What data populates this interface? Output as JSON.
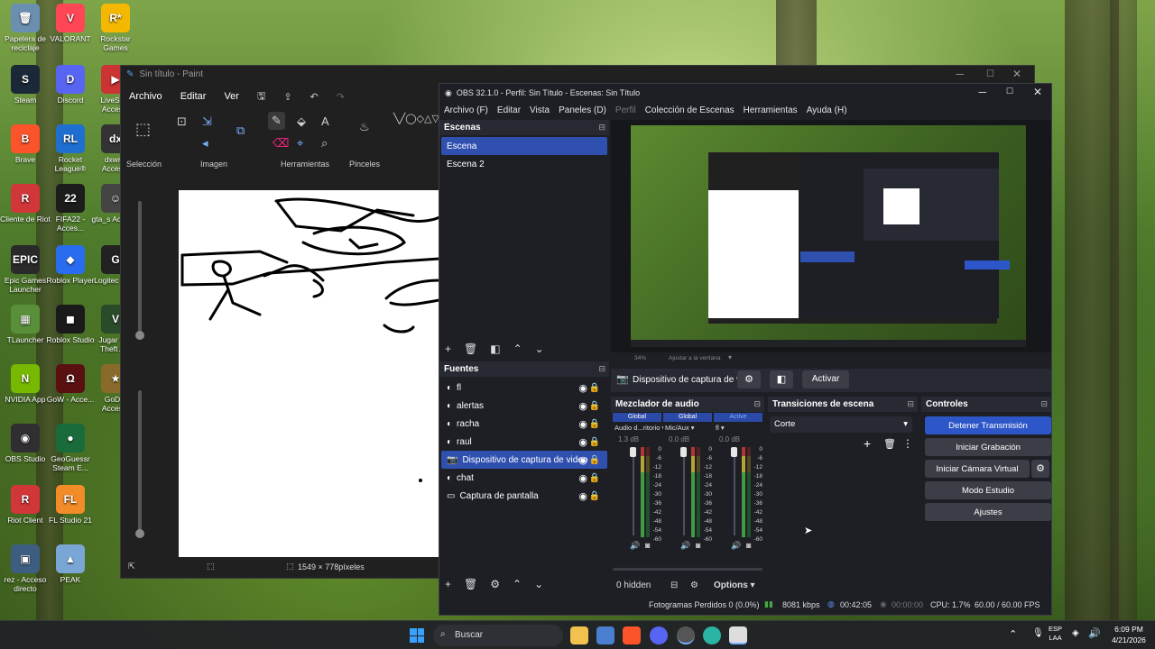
{
  "desktop": {
    "icons": [
      {
        "label": "Papelera de reciclaje",
        "color": "#6b8fb0",
        "glyph": "🗑"
      },
      {
        "label": "Steam",
        "color": "#1b2838",
        "glyph": "S"
      },
      {
        "label": "Brave",
        "color": "#fb542b",
        "glyph": "B"
      },
      {
        "label": "Cliente de Riot",
        "color": "#d13639",
        "glyph": "R"
      },
      {
        "label": "Epic Games Launcher",
        "color": "#2a2a2a",
        "glyph": "EPIC"
      },
      {
        "label": "TLauncher",
        "color": "#5a8f3a",
        "glyph": "▦"
      },
      {
        "label": "NVIDIA App",
        "color": "#76b900",
        "glyph": "N"
      },
      {
        "label": "OBS Studio",
        "color": "#302e31",
        "glyph": "◉"
      },
      {
        "label": "Riot Client",
        "color": "#d13639",
        "glyph": "R"
      },
      {
        "label": "rez - Acceso directo",
        "color": "#3d5e80",
        "glyph": "▣"
      },
      {
        "label": "VALORANT",
        "color": "#ff4655",
        "glyph": "V"
      },
      {
        "label": "Discord",
        "color": "#5865f2",
        "glyph": "D"
      },
      {
        "label": "Rocket League®",
        "color": "#1f6fd1",
        "glyph": "RL"
      },
      {
        "label": "FIFA22 - Acces...",
        "color": "#1c1c1c",
        "glyph": "22"
      },
      {
        "label": "Roblox Player",
        "color": "#2a6cf0",
        "glyph": "◆"
      },
      {
        "label": "Roblox Studio",
        "color": "#1a1a1a",
        "glyph": "◼"
      },
      {
        "label": "GoW - Acce...",
        "color": "#5a1010",
        "glyph": "Ω"
      },
      {
        "label": "GeoGuessr Steam E...",
        "color": "#1a6b3c",
        "glyph": "●"
      },
      {
        "label": "FL Studio 21",
        "color": "#f28c28",
        "glyph": "FL"
      },
      {
        "label": "PEAK",
        "color": "#7aa6d6",
        "glyph": "▲"
      },
      {
        "label": "Rockstar Games",
        "color": "#f5b800",
        "glyph": "R*"
      },
      {
        "label": "LiveSp... Acces...",
        "color": "#c33",
        "glyph": "▶"
      },
      {
        "label": "dxwnd Acces...",
        "color": "#333",
        "glyph": "dx"
      },
      {
        "label": "gta_s Acces...",
        "color": "#444",
        "glyph": "☺"
      },
      {
        "label": "Logitec HUB",
        "color": "#222",
        "glyph": "G"
      },
      {
        "label": "Jugar G... Theft A...",
        "color": "#2a4a2a",
        "glyph": "V"
      },
      {
        "label": "GoD... Acces...",
        "color": "#8a6a2a",
        "glyph": "★"
      }
    ]
  },
  "paint": {
    "title": "Sin título - Paint",
    "menu": [
      "Archivo",
      "Editar",
      "Ver"
    ],
    "groups": [
      "Selección",
      "Imagen",
      "Herramientas",
      "Pinceles"
    ],
    "status_size": "1549 × 778píxeles"
  },
  "obs": {
    "title": "OBS 32.1.0 - Perfil: Sin Título - Escenas: Sin Título",
    "menu": [
      "Archivo (F)",
      "Editar",
      "Vista",
      "Paneles (D)",
      "Perfil",
      "Colección de Escenas",
      "Herramientas",
      "Ayuda (H)"
    ],
    "scenes": {
      "header": "Escenas",
      "items": [
        "Escena",
        "Escena 2"
      ]
    },
    "sources": {
      "header": "Fuentes",
      "items": [
        "fl",
        "alertas",
        "racha",
        "raul",
        "Dispositivo de captura de video",
        "chat",
        "Captura de pantalla"
      ]
    },
    "preview": {
      "zoom": "34%",
      "fit": "Ajustar a la ventana"
    },
    "source_bar": {
      "name": "Dispositivo de captura de v",
      "activate": "Activar"
    },
    "mixer": {
      "header": "Mezclador de audio",
      "channels": [
        {
          "tag": "Global",
          "name": "Audio d...ritorio",
          "db": "1.3 dB"
        },
        {
          "tag": "Global",
          "name": "Mic/Aux",
          "db": "0.0 dB"
        },
        {
          "tag": "Active",
          "name": "fl",
          "db": "0.0 dB"
        }
      ],
      "ticks": [
        "0",
        "-6",
        "-12",
        "-18",
        "-24",
        "-30",
        "-36",
        "-42",
        "-48",
        "-54",
        "-60"
      ],
      "hidden": "0 hidden",
      "options": "Options"
    },
    "transitions": {
      "header": "Transiciones de escena",
      "selected": "Corte"
    },
    "controls": {
      "header": "Controles",
      "stop_stream": "Detener Transmisión",
      "start_rec": "Iniciar Grabación",
      "virtual_cam": "Iniciar Cámara Virtual",
      "studio": "Modo Estudio",
      "settings": "Ajustes"
    },
    "status": {
      "dropped": "Fotogramas Perdidos 0 (0.0%)",
      "bitrate": "8081 kbps",
      "stream_time": "00:42:05",
      "rec_time": "00:00:00",
      "cpu": "CPU: 1.7%",
      "fps": "60.00 / 60.00 FPS"
    }
  },
  "taskbar": {
    "search": "Buscar",
    "lang": "ESP",
    "lang2": "LAA",
    "time": "6:09 PM",
    "date": "4/21/2026"
  }
}
